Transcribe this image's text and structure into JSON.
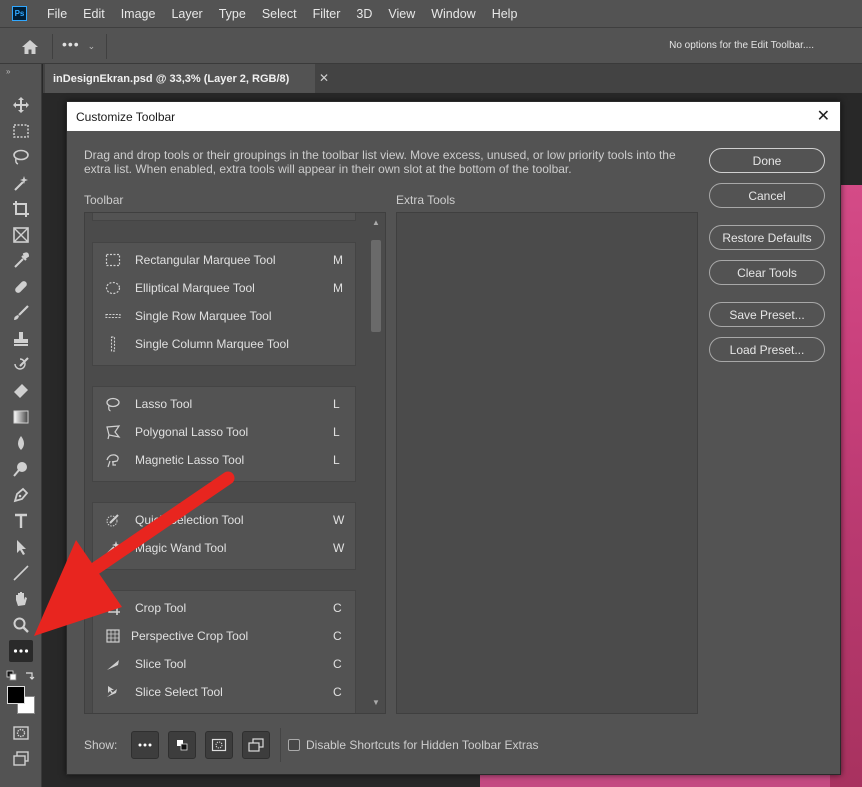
{
  "menu": [
    "File",
    "Edit",
    "Image",
    "Layer",
    "Type",
    "Select",
    "Filter",
    "3D",
    "View",
    "Window",
    "Help"
  ],
  "app_logo": "Ps",
  "options_bar": {
    "dots": "•••",
    "message": "No options for the Edit Toolbar...."
  },
  "document_tab": {
    "title": "inDesignEkran.psd @ 33,3% (Layer 2, RGB/8)",
    "close": "✕"
  },
  "dialog": {
    "title": "Customize Toolbar",
    "close": "✕",
    "description": "Drag and drop tools or their groupings in the toolbar list view. Move excess, unused, or low priority tools into the extra list. When enabled, extra tools will appear in their own slot at the bottom of the toolbar.",
    "toolbar_label": "Toolbar",
    "extra_label": "Extra Tools",
    "groups": [
      {
        "tools": [
          {
            "label": "Rectangular Marquee Tool",
            "key": "M",
            "icon": "rect-marquee-icon"
          },
          {
            "label": "Elliptical Marquee Tool",
            "key": "M",
            "icon": "ellipse-marquee-icon"
          },
          {
            "label": "Single Row Marquee Tool",
            "key": "",
            "icon": "row-marquee-icon"
          },
          {
            "label": "Single Column Marquee Tool",
            "key": "",
            "icon": "column-marquee-icon"
          }
        ]
      },
      {
        "tools": [
          {
            "label": "Lasso Tool",
            "key": "L",
            "icon": "lasso-icon"
          },
          {
            "label": "Polygonal Lasso Tool",
            "key": "L",
            "icon": "polygonal-lasso-icon"
          },
          {
            "label": "Magnetic Lasso Tool",
            "key": "L",
            "icon": "magnetic-lasso-icon"
          }
        ]
      },
      {
        "tools": [
          {
            "label": "Quick Selection Tool",
            "key": "W",
            "icon": "quick-selection-icon"
          },
          {
            "label": "Magic Wand Tool",
            "key": "W",
            "icon": "magic-wand-icon"
          }
        ]
      },
      {
        "tools": [
          {
            "label": "Crop Tool",
            "key": "C",
            "icon": "crop-icon"
          },
          {
            "label": "Perspective Crop Tool",
            "key": "C",
            "icon": "perspective-crop-icon"
          },
          {
            "label": "Slice Tool",
            "key": "C",
            "icon": "slice-icon"
          },
          {
            "label": "Slice Select Tool",
            "key": "C",
            "icon": "slice-select-icon"
          }
        ]
      }
    ],
    "buttons": {
      "done": "Done",
      "cancel": "Cancel",
      "restore": "Restore Defaults",
      "clear": "Clear Tools",
      "save": "Save Preset...",
      "load": "Load Preset..."
    },
    "show_label": "Show:",
    "checkbox_label": "Disable Shortcuts for Hidden Toolbar Extras"
  },
  "colors": {
    "accent_arrow": "#e8251f",
    "panel": "#535353",
    "artwork": "#c9407c"
  }
}
